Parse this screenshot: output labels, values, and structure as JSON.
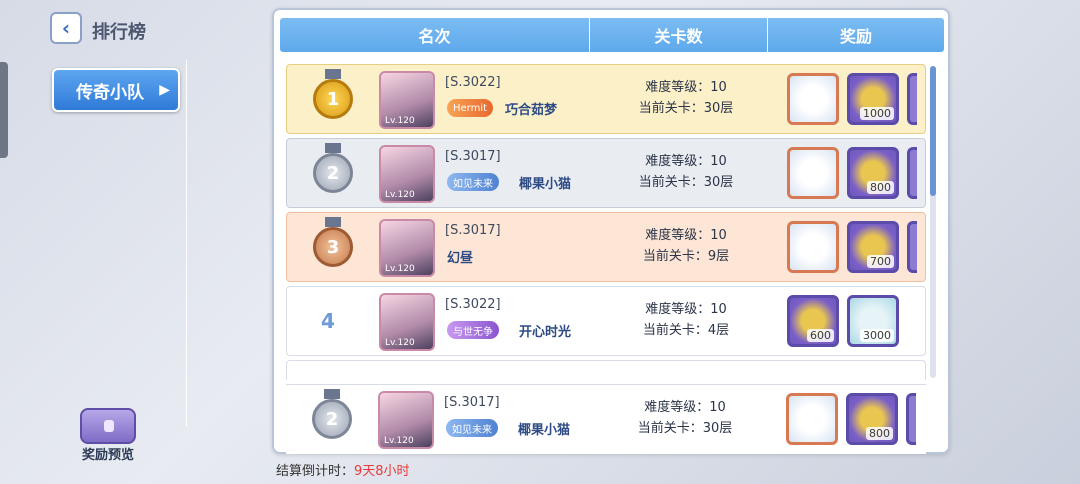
{
  "nav": {
    "title": "排行榜",
    "back_icon": "chevron-left-icon"
  },
  "sidebar": {
    "tab_label": "传奇小队",
    "reward_preview_label": "奖励预览"
  },
  "table": {
    "headers": [
      "名次",
      "关卡数",
      "奖励"
    ],
    "rows": [
      {
        "rank": "1",
        "level_badge": "Lv.120",
        "server": "[S.3022]",
        "title_badge": "Hermit",
        "name": "巧合茹梦",
        "difficulty": "难度等级：10",
        "stage": "当前关卡：30层",
        "rewards": [
          "",
          "1000"
        ]
      },
      {
        "rank": "2",
        "level_badge": "Lv.120",
        "server": "[S.3017]",
        "title_badge": "如见未来",
        "name": "椰果小猫",
        "difficulty": "难度等级：10",
        "stage": "当前关卡：30层",
        "rewards": [
          "",
          "800"
        ]
      },
      {
        "rank": "3",
        "level_badge": "Lv.120",
        "server": "[S.3017]",
        "title_badge": "",
        "name": "幻昼",
        "difficulty": "难度等级：10",
        "stage": "当前关卡：9层",
        "rewards": [
          "",
          "700"
        ]
      },
      {
        "rank": "4",
        "level_badge": "Lv.120",
        "server": "[S.3022]",
        "title_badge": "与世无争",
        "name": "开心时光",
        "difficulty": "难度等级：10",
        "stage": "当前关卡：4层",
        "rewards": [
          "600",
          "3000"
        ]
      }
    ],
    "my_row": {
      "rank": "2",
      "level_badge": "Lv.120",
      "server": "[S.3017]",
      "title_badge": "如见未来",
      "name": "椰果小猫",
      "difficulty": "难度等级：10",
      "stage": "当前关卡：30层",
      "rewards": [
        "",
        "800"
      ]
    }
  },
  "footer": {
    "countdown_label": "结算倒计时：",
    "countdown_value": "9天8小时"
  }
}
